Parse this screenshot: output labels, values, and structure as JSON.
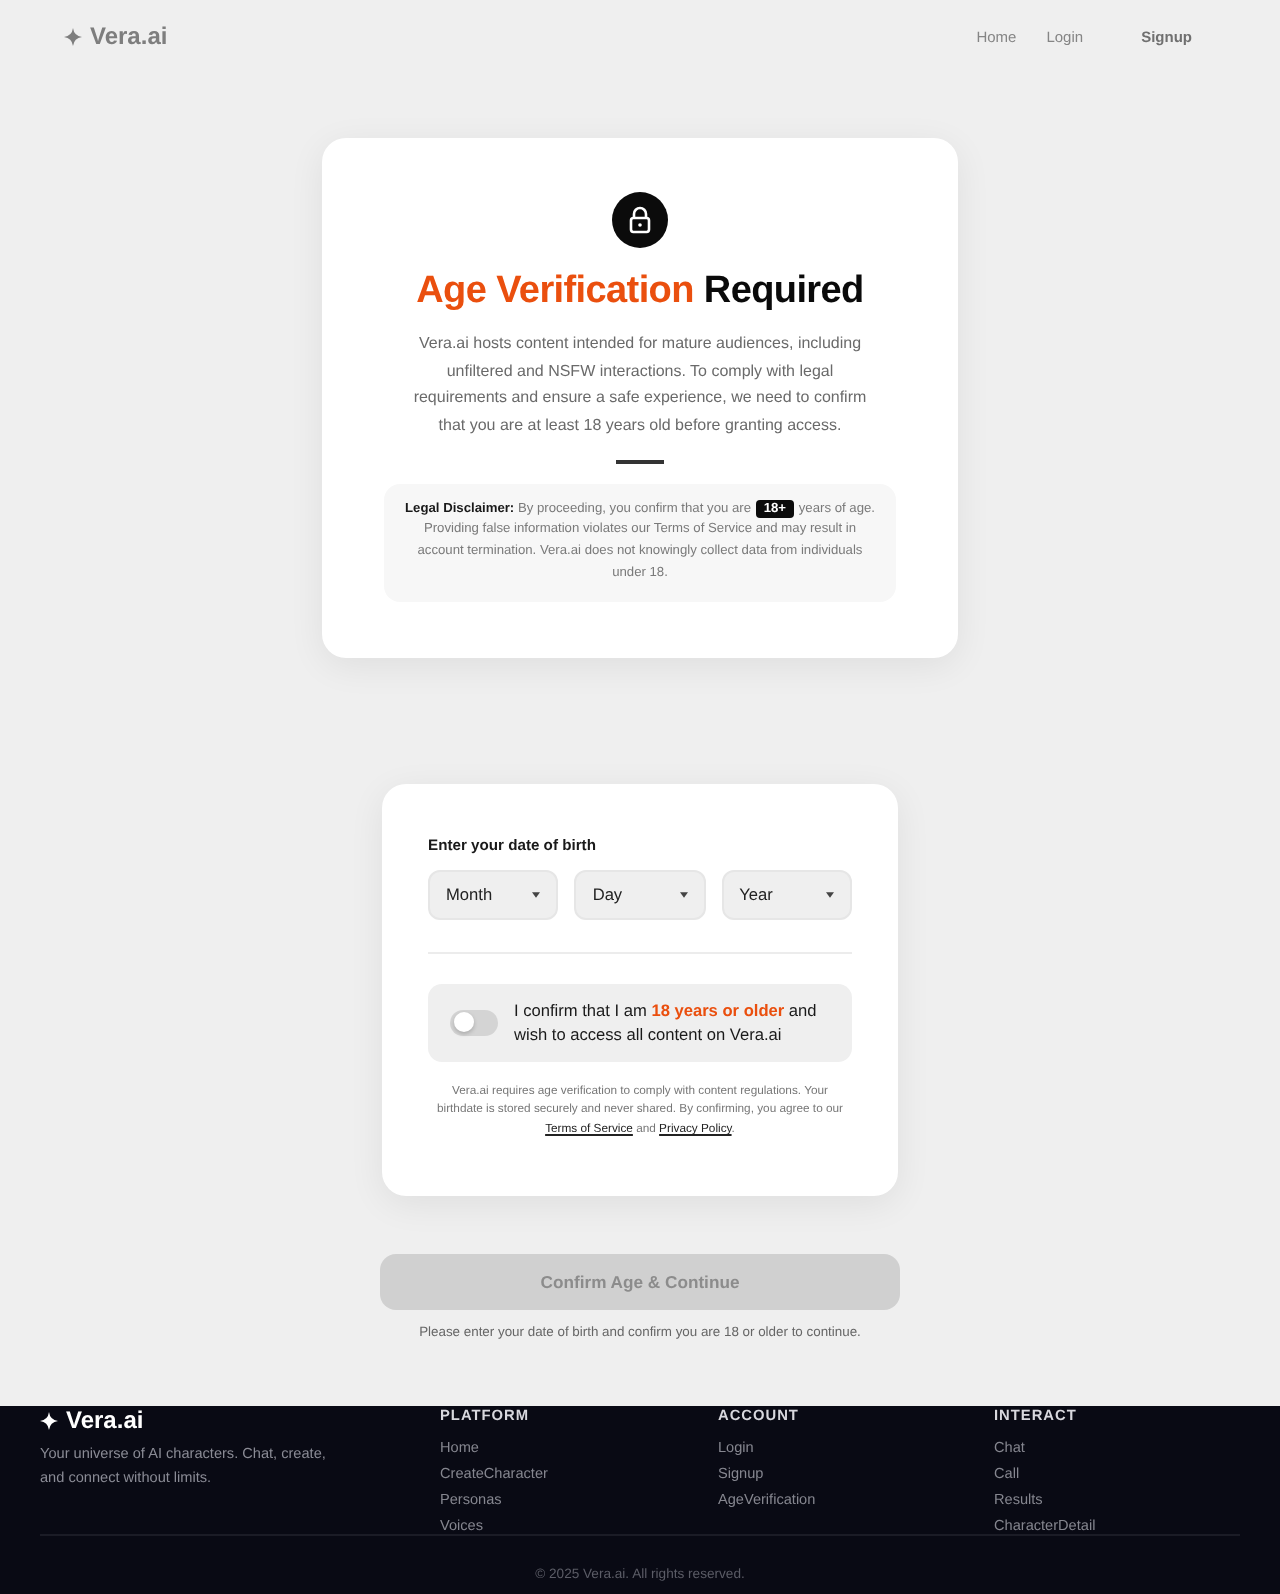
{
  "header": {
    "logo": "Vera.ai",
    "nav": [
      {
        "label": "Home",
        "kind": "link"
      },
      {
        "label": "Login",
        "kind": "link"
      },
      {
        "label": "Signup",
        "kind": "button"
      }
    ]
  },
  "intro_card": {
    "title_highlight": "Age Verification",
    "title_rest": "Required",
    "description": "Vera.ai hosts content intended for mature audiences, including unfiltered and NSFW interactions. To comply with legal requirements and ensure a safe experience, we need to confirm that you are at least 18 years old before granting access.",
    "disclaimer": {
      "label": "Legal Disclaimer:",
      "text_before": "By proceeding, you confirm that you are",
      "badge": "18+",
      "text_after": "years of age. Providing false information violates our Terms of Service and may result in account termination. Vera.ai does not knowingly collect data from individuals under 18."
    }
  },
  "form_card": {
    "label": "Enter your date of birth",
    "date_fields": [
      {
        "placeholder": "Month"
      },
      {
        "placeholder": "Day"
      },
      {
        "placeholder": "Year"
      }
    ],
    "confirmation": {
      "text": "I confirm that I am **18 years or older** and wish to access all content on Vera.ai",
      "on": false
    },
    "note": {
      "text": "Vera.ai requires age verification to comply with content regulations. Your birthdate is stored securely and never shared. By confirming, you agree to our",
      "links": [
        "Terms of Service",
        "Privacy Policy"
      ],
      "joiner": "and",
      "end": "."
    }
  },
  "submit": {
    "label": "Confirm Age & Continue",
    "disabled": true,
    "hint": "Please enter your date of birth and confirm you are 18 or older to continue."
  },
  "footer": {
    "logo": "Vera.ai",
    "tagline": "Your universe of AI characters. Chat, create, and connect without limits.",
    "columns": [
      {
        "heading": "PLATFORM",
        "links": [
          "Home",
          "CreateCharacter",
          "Personas",
          "Voices"
        ]
      },
      {
        "heading": "ACCOUNT",
        "links": [
          "Login",
          "Signup",
          "AgeVerification"
        ]
      },
      {
        "heading": "INTERACT",
        "links": [
          "Chat",
          "Call",
          "Results",
          "CharacterDetail"
        ]
      }
    ],
    "copyright": "© 2025 Vera.ai. All rights reserved."
  }
}
